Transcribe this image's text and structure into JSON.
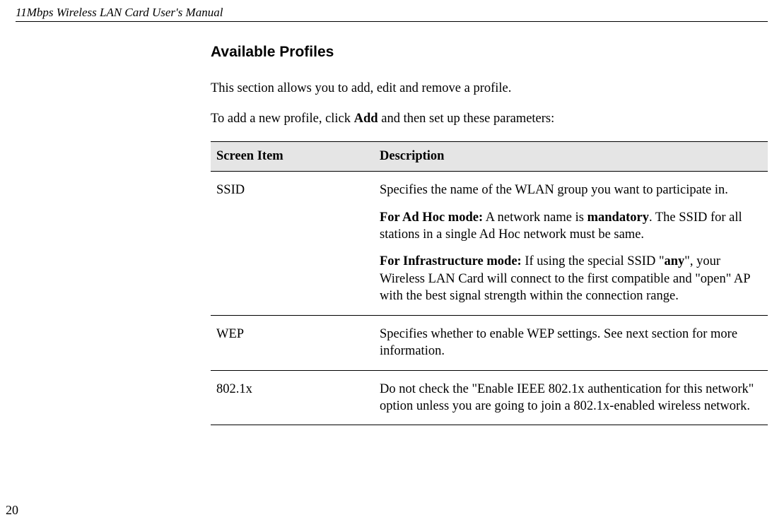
{
  "header": {
    "title": "11Mbps Wireless LAN Card User's Manual"
  },
  "section": {
    "heading": "Available Profiles",
    "intro1": "This section allows you to add, edit and remove a profile.",
    "intro2_pre": "To add a new profile, click ",
    "intro2_bold": "Add",
    "intro2_post": " and then set up these parameters:"
  },
  "table": {
    "col1": "Screen Item",
    "col2": "Description",
    "rows": [
      {
        "item": "SSID",
        "blocks": [
          {
            "plain": "Specifies the name of the WLAN group you want to participate in."
          },
          {
            "bold_lead": "For Ad Hoc mode:",
            "rest_a": " A network name is ",
            "bold_mid": "mandatory",
            "rest_b": ". The SSID for all stations in a single Ad Hoc network must be same."
          },
          {
            "bold_lead": "For Infrastructure mode:",
            "rest_a": " If using the special SSID \"",
            "bold_mid": "any",
            "rest_b": "\", your Wireless LAN Card will connect to the first compatible and \"open\" AP with the best signal strength within the connection range."
          }
        ]
      },
      {
        "item": "WEP",
        "blocks": [
          {
            "plain": "Specifies whether to enable WEP settings. See next section for more information."
          }
        ]
      },
      {
        "item": "802.1x",
        "blocks": [
          {
            "plain": "Do not check the \"Enable IEEE 802.1x authentication for this network\" option unless you are going to join a 802.1x-enabled wireless network."
          }
        ]
      }
    ]
  },
  "page_number": "20"
}
